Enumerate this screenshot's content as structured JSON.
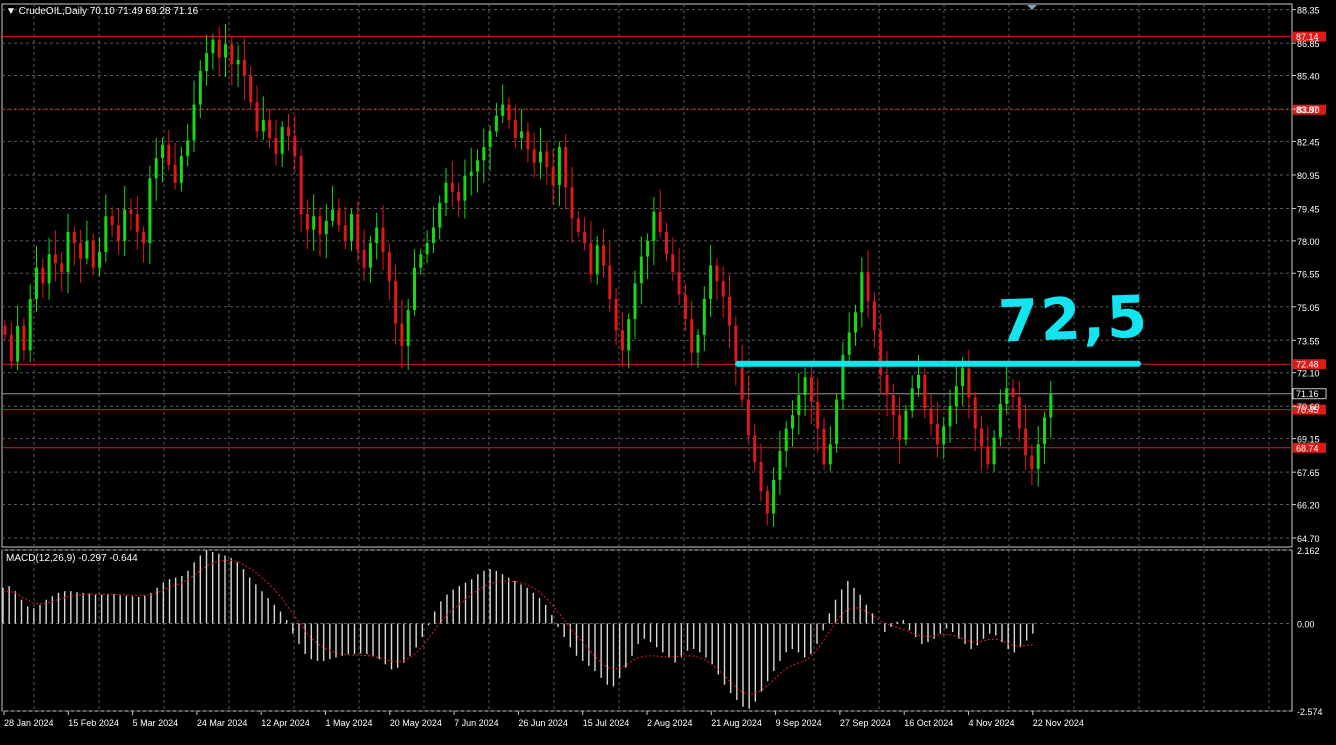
{
  "price_title": "▼ CrudeOIL,Daily  70.10 71.49 69.28 71.16",
  "macd_title": "MACD(12,26,9) -0.297 -0.644",
  "annotation": "72,5",
  "colors": {
    "background": "#000000",
    "grid": "#5a5a5a",
    "bull": "#16d916",
    "bear": "#e01818",
    "level_line": "#e01818",
    "annotation": "#12e5f0",
    "macd_hist": "#d8d8d8",
    "macd_signal": "#e02020",
    "text": "#ffffff"
  },
  "chart_data": [
    {
      "type": "candlestick",
      "title": "CrudeOIL,Daily",
      "ohlc_last": {
        "open": 70.1,
        "high": 71.49,
        "low": 69.28,
        "close": 71.16
      },
      "ylim": [
        64.3,
        88.6
      ],
      "y_ticks": [
        "88.35",
        "86.85",
        "85.40",
        "83.90",
        "82.45",
        "80.95",
        "79.45",
        "78.00",
        "76.55",
        "75.05",
        "73.55",
        "72.10",
        "70.60",
        "69.15",
        "67.65",
        "66.20",
        "64.70"
      ],
      "x_tick_labels": [
        "28 Jan 2024",
        "15 Feb 2024",
        "5 Mar 2024",
        "24 Mar 2024",
        "12 Apr 2024",
        "1 May 2024",
        "20 May 2024",
        "7 Jun 2024",
        "26 Jun 2024",
        "15 Jul 2024",
        "2 Aug 2024",
        "21 Aug 2024",
        "9 Sep 2024",
        "27 Sep 2024",
        "16 Oct 2024",
        "4 Nov 2024",
        "22 Nov 2024"
      ],
      "levels": [
        {
          "value": 87.14,
          "label": "87.14",
          "style": "solid"
        },
        {
          "value": 83.87,
          "label": "83.87",
          "style": "dotted"
        },
        {
          "value": 72.48,
          "label": "72.48",
          "style": "solid"
        },
        {
          "value": 70.45,
          "label": "70.45",
          "style": "solid"
        },
        {
          "value": 68.74,
          "label": "68.74",
          "style": "solid"
        }
      ],
      "current_price": {
        "value": 71.16,
        "label": "71.16"
      },
      "drawn_level": {
        "value": 72.5,
        "label": "72,5"
      },
      "closes": [
        73.8,
        72.6,
        74.2,
        73.1,
        75.4,
        76.8,
        76.1,
        77.4,
        77.0,
        76.6,
        78.4,
        77.9,
        77.2,
        78.0,
        76.8,
        77.5,
        79.1,
        78.7,
        78.0,
        79.4,
        79.2,
        78.4,
        77.9,
        80.8,
        81.7,
        82.3,
        81.4,
        80.6,
        81.8,
        82.5,
        84.1,
        85.6,
        86.4,
        87.0,
        86.2,
        86.8,
        85.9,
        86.1,
        85.4,
        84.2,
        82.9,
        83.4,
        82.6,
        81.9,
        83.1,
        82.7,
        81.8,
        79.2,
        78.5,
        79.1,
        78.3,
        78.9,
        79.4,
        78.7,
        78.0,
        79.2,
        77.6,
        76.8,
        77.9,
        78.6,
        77.5,
        76.2,
        74.3,
        73.3,
        74.9,
        76.8,
        77.4,
        77.9,
        78.6,
        79.7,
        80.6,
        80.2,
        79.8,
        80.9,
        81.1,
        81.6,
        82.2,
        82.9,
        83.6,
        84.1,
        83.4,
        82.6,
        82.9,
        82.1,
        81.5,
        82.0,
        81.3,
        80.5,
        82.2,
        80.4,
        79.0,
        78.4,
        77.9,
        76.5,
        77.8,
        76.9,
        75.4,
        74.0,
        73.1,
        74.5,
        76.1,
        77.3,
        78.0,
        79.3,
        78.4,
        77.4,
        76.6,
        75.6,
        74.5,
        73.0,
        73.8,
        75.4,
        76.9,
        76.2,
        75.5,
        74.2,
        72.6,
        70.9,
        69.3,
        68.1,
        66.8,
        65.8,
        67.3,
        68.6,
        69.6,
        70.2,
        71.1,
        71.9,
        70.8,
        69.6,
        68.0,
        68.9,
        70.9,
        72.9,
        73.9,
        74.8,
        76.6,
        75.3,
        74.0,
        72.0,
        71.1,
        70.2,
        69.1,
        70.4,
        71.4,
        72.0,
        70.5,
        69.8,
        68.9,
        69.7,
        70.6,
        71.5,
        72.3,
        71.0,
        69.6,
        68.8,
        68.0,
        69.2,
        70.7,
        71.4,
        71.0,
        69.6,
        68.4,
        67.8,
        68.9,
        70.1,
        71.16
      ]
    },
    {
      "type": "bar",
      "title": "MACD(12,26,9)",
      "main": -0.297,
      "signal": -0.644,
      "ylim": [
        -2.574,
        2.162
      ],
      "y_ticks": [
        "2.162",
        "0.00",
        "-2.574"
      ],
      "histogram": [
        1.05,
        1.1,
        0.95,
        0.7,
        0.5,
        0.45,
        0.55,
        0.7,
        0.8,
        0.9,
        0.95,
        0.95,
        0.92,
        0.9,
        0.88,
        0.85,
        0.85,
        0.87,
        0.86,
        0.83,
        0.82,
        0.8,
        0.78,
        0.82,
        0.9,
        1.05,
        1.2,
        1.3,
        1.35,
        1.4,
        1.55,
        1.8,
        2.0,
        2.15,
        2.1,
        2.05,
        2.0,
        1.92,
        1.8,
        1.6,
        1.35,
        1.15,
        0.95,
        0.75,
        0.55,
        0.35,
        0.1,
        -0.3,
        -0.6,
        -0.9,
        -1.05,
        -1.1,
        -1.1,
        -1.05,
        -1.0,
        -0.95,
        -0.9,
        -0.9,
        -0.88,
        -0.9,
        -0.95,
        -1.05,
        -1.2,
        -1.35,
        -1.3,
        -1.15,
        -0.95,
        -0.7,
        -0.4,
        -0.05,
        0.35,
        0.65,
        0.85,
        1.0,
        1.1,
        1.2,
        1.3,
        1.45,
        1.55,
        1.6,
        1.55,
        1.45,
        1.35,
        1.25,
        1.15,
        1.05,
        0.9,
        0.75,
        0.55,
        0.25,
        -0.1,
        -0.4,
        -0.7,
        -0.95,
        -1.1,
        -1.25,
        -1.4,
        -1.6,
        -1.8,
        -1.85,
        -1.6,
        -1.3,
        -0.95,
        -0.6,
        -0.45,
        -0.55,
        -0.7,
        -0.85,
        -1.0,
        -1.15,
        -1.0,
        -0.8,
        -0.75,
        -0.85,
        -1.0,
        -1.2,
        -1.5,
        -1.8,
        -2.05,
        -2.25,
        -2.45,
        -2.5,
        -2.3,
        -2.0,
        -1.7,
        -1.4,
        -1.1,
        -0.85,
        -0.75,
        -0.85,
        -1.0,
        -0.9,
        -0.6,
        -0.2,
        0.3,
        0.7,
        1.0,
        1.25,
        1.05,
        0.85,
        0.55,
        0.3,
        0.0,
        -0.25,
        -0.1,
        0.05,
        0.1,
        -0.2,
        -0.4,
        -0.6,
        -0.55,
        -0.45,
        -0.3,
        -0.15,
        -0.25,
        -0.45,
        -0.6,
        -0.75,
        -0.65,
        -0.45,
        -0.3,
        -0.35,
        -0.55,
        -0.75,
        -0.85,
        -0.7,
        -0.5,
        -0.3
      ],
      "signal_line": [
        0.95,
        0.95,
        0.9,
        0.8,
        0.7,
        0.6,
        0.58,
        0.6,
        0.64,
        0.7,
        0.75,
        0.8,
        0.83,
        0.85,
        0.86,
        0.86,
        0.86,
        0.86,
        0.86,
        0.85,
        0.85,
        0.84,
        0.83,
        0.83,
        0.84,
        0.88,
        0.94,
        1.02,
        1.09,
        1.16,
        1.24,
        1.35,
        1.48,
        1.62,
        1.72,
        1.8,
        1.84,
        1.86,
        1.85,
        1.8,
        1.7,
        1.6,
        1.45,
        1.3,
        1.15,
        0.95,
        0.75,
        0.5,
        0.25,
        0.0,
        -0.25,
        -0.45,
        -0.6,
        -0.72,
        -0.8,
        -0.86,
        -0.9,
        -0.92,
        -0.93,
        -0.93,
        -0.94,
        -0.96,
        -1.0,
        -1.06,
        -1.1,
        -1.12,
        -1.1,
        -1.02,
        -0.9,
        -0.72,
        -0.5,
        -0.25,
        0.0,
        0.2,
        0.38,
        0.52,
        0.66,
        0.8,
        0.93,
        1.05,
        1.14,
        1.2,
        1.24,
        1.25,
        1.24,
        1.22,
        1.17,
        1.1,
        1.0,
        0.85,
        0.68,
        0.48,
        0.25,
        0.02,
        -0.2,
        -0.42,
        -0.62,
        -0.82,
        -1.02,
        -1.2,
        -1.3,
        -1.34,
        -1.3,
        -1.2,
        -1.08,
        -1.0,
        -0.96,
        -0.95,
        -0.96,
        -0.98,
        -0.99,
        -0.98,
        -0.96,
        -0.95,
        -0.96,
        -1.0,
        -1.08,
        -1.2,
        -1.35,
        -1.52,
        -1.7,
        -1.88,
        -2.02,
        -2.08,
        -2.06,
        -1.98,
        -1.86,
        -1.7,
        -1.52,
        -1.36,
        -1.25,
        -1.18,
        -1.12,
        -1.02,
        -0.85,
        -0.62,
        -0.35,
        -0.08,
        0.18,
        0.35,
        0.45,
        0.46,
        0.4,
        0.3,
        0.18,
        0.06,
        -0.02,
        -0.08,
        -0.14,
        -0.2,
        -0.28,
        -0.34,
        -0.38,
        -0.38,
        -0.35,
        -0.32,
        -0.32,
        -0.36,
        -0.42,
        -0.5,
        -0.54,
        -0.54,
        -0.5,
        -0.46,
        -0.47,
        -0.52,
        -0.6,
        -0.66,
        -0.66,
        -0.64,
        -0.62
      ]
    }
  ]
}
